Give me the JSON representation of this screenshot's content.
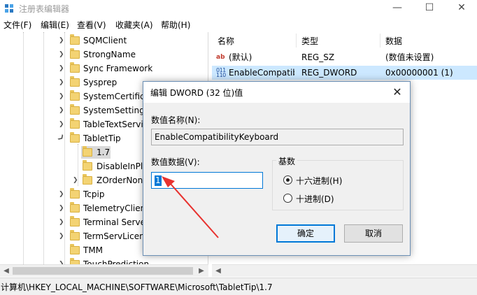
{
  "window": {
    "title": "注册表编辑器",
    "min_glyph": "—",
    "max_glyph": "☐",
    "close_glyph": "✕"
  },
  "menu": [
    "文件(F)",
    "编辑(E)",
    "查看(V)",
    "收藏夹(A)",
    "帮助(H)"
  ],
  "tree": {
    "items": [
      {
        "label": "SQMClient",
        "expandable": true
      },
      {
        "label": "StrongName",
        "expandable": true
      },
      {
        "label": "Sync Framework",
        "expandable": true
      },
      {
        "label": "Sysprep",
        "expandable": true
      },
      {
        "label": "SystemCertificates",
        "expandable": true
      },
      {
        "label": "SystemSettings",
        "expandable": true
      },
      {
        "label": "TableTextService",
        "expandable": true
      },
      {
        "label": "TabletTip",
        "expandable": true,
        "expanded": true
      },
      {
        "label": "1.7",
        "expandable": false,
        "selected": true,
        "level": 1
      },
      {
        "label": "DisableInPlace",
        "expandable": false,
        "level": 2
      },
      {
        "label": "ZOrderNone",
        "expandable": true,
        "level": 2
      },
      {
        "label": "Tcpip",
        "expandable": true
      },
      {
        "label": "TelemetryClient",
        "expandable": true
      },
      {
        "label": "Terminal Server",
        "expandable": true
      },
      {
        "label": "TermServLicensing",
        "expandable": true
      },
      {
        "label": "TMM",
        "expandable": false
      },
      {
        "label": "TouchPrediction",
        "expandable": true
      }
    ]
  },
  "values_pane": {
    "headers": [
      "名称",
      "类型",
      "数据"
    ],
    "rows": [
      {
        "icon": "string-value-icon",
        "name": "(默认)",
        "type": "REG_SZ",
        "data": "(数值未设置)",
        "selected": false
      },
      {
        "icon": "binary-value-icon",
        "name": "EnableCompatibilityKeyboard",
        "type": "REG_DWORD",
        "data": "0x00000001 (1)",
        "selected": true
      }
    ]
  },
  "statusbar": {
    "path": "计算机\\HKEY_LOCAL_MACHINE\\SOFTWARE\\Microsoft\\TabletTip\\1.7"
  },
  "dialog": {
    "title": "编辑 DWORD (32 位)值",
    "close_glyph": "✕",
    "name_label": "数值名称(N):",
    "name_value": "EnableCompatibilityKeyboard",
    "data_label": "数值数据(V):",
    "data_value": "1",
    "base_group": "基数",
    "base_hex": "十六进制(H)",
    "base_dec": "十进制(D)",
    "base_selected": "hex",
    "ok_label": "确定",
    "cancel_label": "取消"
  },
  "colors": {
    "selection": "#cce8ff",
    "accent": "#0078d7",
    "annotation_arrow": "#e8322f"
  }
}
